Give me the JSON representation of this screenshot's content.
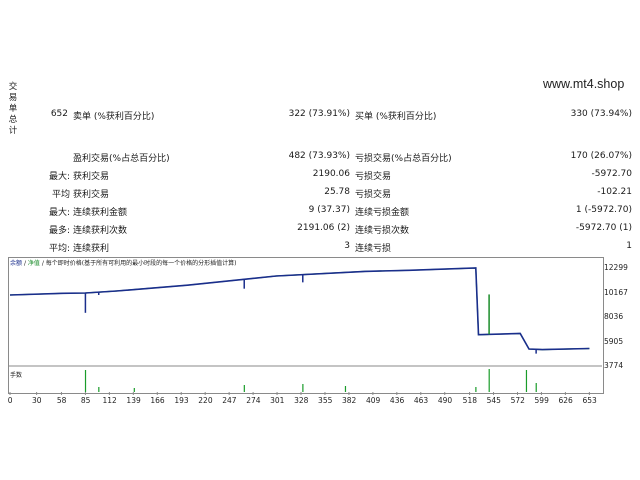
{
  "sidebar_label_chars": [
    "交",
    "易",
    "单",
    "总",
    "计"
  ],
  "site": "www.mt4.shop",
  "stats": [
    {
      "c1": "652",
      "c2": "卖单 (%获利百分比)",
      "c3": "322 (73.91%)",
      "c4": "买单 (%获利百分比)",
      "c5": "330 (73.94%)"
    },
    {
      "c1": "",
      "c2": "盈利交易(%占总百分比)",
      "c3": "482 (73.93%)",
      "c4": "亏损交易(%占总百分比)",
      "c5": "170 (26.07%)"
    },
    {
      "c1": "最大:",
      "c2": "获利交易",
      "c3": "2190.06",
      "c4": "亏损交易",
      "c5": "-5972.70"
    },
    {
      "c1": "平均",
      "c2": "获利交易",
      "c3": "25.78",
      "c4": "亏损交易",
      "c5": "-102.21"
    },
    {
      "c1": "最大:",
      "c2": "连续获利金额",
      "c3": "9 (37.37)",
      "c4": "连续亏损金额",
      "c5": "1 (-5972.70)"
    },
    {
      "c1": "最多:",
      "c2": "连续获利次数",
      "c3": "2191.06 (2)",
      "c4": "连续亏损次数",
      "c5": "-5972.70 (1)"
    },
    {
      "c1": "平均:",
      "c2": "连续获利",
      "c3": "3",
      "c4": "连续亏损",
      "c5": "1"
    }
  ],
  "chart_legend": {
    "balance": "余额",
    "equity": "净值",
    "desc": "每个即时价格(基于所有可利用的最小时段的每一个价格的分形插值计算)"
  },
  "volume_label": "手数",
  "chart_data": {
    "type": "line",
    "x_ticks": [
      0,
      30,
      58,
      85,
      112,
      139,
      166,
      193,
      220,
      247,
      274,
      301,
      328,
      355,
      382,
      409,
      436,
      463,
      490,
      518,
      545,
      572,
      599,
      626,
      653
    ],
    "y_ticks": [
      12299,
      10167,
      8036,
      5905,
      3774
    ],
    "xlim": [
      0,
      665
    ],
    "ylim": [
      3774,
      12299
    ],
    "series": [
      {
        "color": "#1a2e8c",
        "points": [
          [
            0,
            9950
          ],
          [
            60,
            10100
          ],
          [
            85,
            10120
          ],
          [
            120,
            10300
          ],
          [
            200,
            10800
          ],
          [
            300,
            11600
          ],
          [
            400,
            12000
          ],
          [
            450,
            12100
          ],
          [
            525,
            12299
          ],
          [
            528,
            6500
          ],
          [
            575,
            6600
          ],
          [
            585,
            5250
          ],
          [
            600,
            5200
          ],
          [
            653,
            5300
          ]
        ]
      },
      {
        "color": "#1a8c2a",
        "points": [
          [
            0,
            9950
          ],
          [
            60,
            10100
          ],
          [
            85,
            10120
          ],
          [
            120,
            10300
          ],
          [
            200,
            10800
          ],
          [
            300,
            11600
          ],
          [
            400,
            12000
          ],
          [
            450,
            12100
          ],
          [
            525,
            12299
          ],
          [
            528,
            6500
          ],
          [
            575,
            6600
          ],
          [
            585,
            5250
          ],
          [
            600,
            5200
          ],
          [
            653,
            5300
          ]
        ]
      }
    ],
    "spikes": [
      {
        "x": 85,
        "y": 8400
      },
      {
        "x": 100,
        "y": 9950
      },
      {
        "x": 264,
        "y": 10500
      },
      {
        "x": 330,
        "y": 11050
      },
      {
        "x": 540,
        "y": 10000
      },
      {
        "x": 593,
        "y": 4850
      }
    ],
    "volume_bars": [
      {
        "x": 85,
        "h": 22
      },
      {
        "x": 100,
        "h": 5
      },
      {
        "x": 140,
        "h": 4
      },
      {
        "x": 264,
        "h": 7
      },
      {
        "x": 330,
        "h": 8
      },
      {
        "x": 378,
        "h": 6
      },
      {
        "x": 525,
        "h": 5
      },
      {
        "x": 540,
        "h": 23
      },
      {
        "x": 582,
        "h": 22
      },
      {
        "x": 593,
        "h": 9
      }
    ]
  }
}
